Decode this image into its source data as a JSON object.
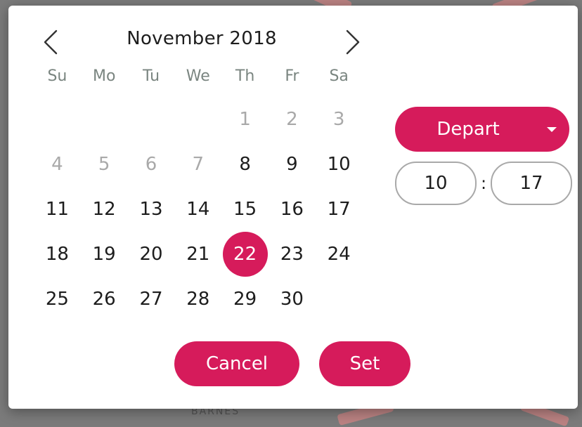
{
  "background": {
    "labels": [
      "BARNES"
    ]
  },
  "calendar": {
    "month_title": "November 2018",
    "prev_icon": "chevron-left-icon",
    "next_icon": "chevron-right-icon",
    "weekdays": [
      "Su",
      "Mo",
      "Tu",
      "We",
      "Th",
      "Fr",
      "Sa"
    ],
    "weeks": [
      [
        {
          "d": ""
        },
        {
          "d": ""
        },
        {
          "d": ""
        },
        {
          "d": ""
        },
        {
          "d": "1",
          "muted": true
        },
        {
          "d": "2",
          "muted": true
        },
        {
          "d": "3",
          "muted": true
        }
      ],
      [
        {
          "d": "4",
          "muted": true
        },
        {
          "d": "5",
          "muted": true
        },
        {
          "d": "6",
          "muted": true
        },
        {
          "d": "7",
          "muted": true
        },
        {
          "d": "8"
        },
        {
          "d": "9"
        },
        {
          "d": "10"
        }
      ],
      [
        {
          "d": "11"
        },
        {
          "d": "12"
        },
        {
          "d": "13"
        },
        {
          "d": "14"
        },
        {
          "d": "15"
        },
        {
          "d": "16"
        },
        {
          "d": "17"
        }
      ],
      [
        {
          "d": "18"
        },
        {
          "d": "19"
        },
        {
          "d": "20"
        },
        {
          "d": "21"
        },
        {
          "d": "22",
          "selected": true
        },
        {
          "d": "23"
        },
        {
          "d": "24"
        }
      ],
      [
        {
          "d": "25"
        },
        {
          "d": "26"
        },
        {
          "d": "27"
        },
        {
          "d": "28"
        },
        {
          "d": "29"
        },
        {
          "d": "30"
        },
        {
          "d": ""
        }
      ]
    ],
    "selected_day": "22"
  },
  "mode": {
    "selected": "Depart",
    "icon": "caret-down-icon"
  },
  "time": {
    "hours": "10",
    "separator": ":",
    "minutes": "17"
  },
  "actions": {
    "cancel_label": "Cancel",
    "set_label": "Set"
  },
  "colors": {
    "accent": "#d61b5b",
    "text": "#1d1d1d",
    "muted": "#a9a9a9",
    "weekday": "#7a8580"
  }
}
